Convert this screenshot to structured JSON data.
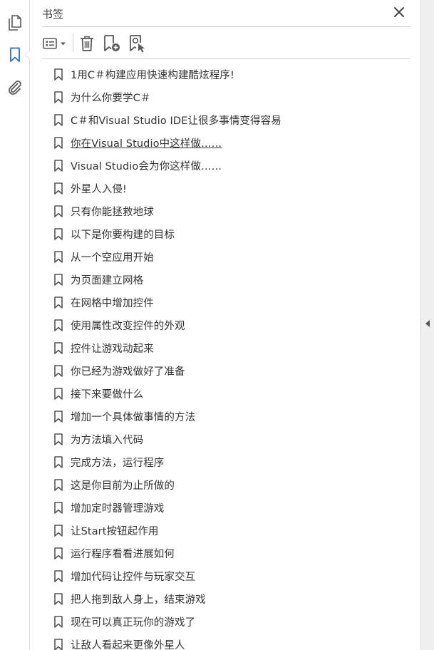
{
  "panel": {
    "title": "书签"
  },
  "icons": {
    "rail": [
      "pages-icon",
      "bookmark-icon",
      "attachment-icon"
    ],
    "toolbar": [
      "options-menu-icon",
      "delete-icon",
      "new-bookmark-icon",
      "bookmark-from-selection-icon"
    ],
    "close": "close-icon"
  },
  "colors": {
    "rail_active": "#2b6fc2",
    "icon_gray": "#5a5a5a",
    "text": "#333333"
  },
  "bookmarks": [
    {
      "label": "1用C＃构建应用快速构建酷炫程序!",
      "underlined": false
    },
    {
      "label": "为什么你要学C＃",
      "underlined": false
    },
    {
      "label": "C＃和Visual Studio IDE让很多事情变得容易",
      "underlined": false
    },
    {
      "label": "你在Visual Studio中这样做……",
      "underlined": true
    },
    {
      "label": "Visual Studio会为你这样做……",
      "underlined": false
    },
    {
      "label": "外星人入侵!",
      "underlined": false
    },
    {
      "label": "只有你能拯救地球",
      "underlined": false
    },
    {
      "label": "以下是你要构建的目标",
      "underlined": false
    },
    {
      "label": "从一个空应用开始",
      "underlined": false
    },
    {
      "label": "为页面建立网格",
      "underlined": false
    },
    {
      "label": "在网格中增加控件",
      "underlined": false
    },
    {
      "label": "使用属性改变控件的外观",
      "underlined": false
    },
    {
      "label": "控件让游戏动起来",
      "underlined": false
    },
    {
      "label": "你已经为游戏做好了准备",
      "underlined": false
    },
    {
      "label": "接下来要做什么",
      "underlined": false
    },
    {
      "label": "增加一个具体做事情的方法",
      "underlined": false
    },
    {
      "label": "为方法填入代码",
      "underlined": false
    },
    {
      "label": "完成方法，运行程序",
      "underlined": false
    },
    {
      "label": "这是你目前为止所做的",
      "underlined": false
    },
    {
      "label": "增加定时器管理游戏",
      "underlined": false
    },
    {
      "label": "让Start按钮起作用",
      "underlined": false
    },
    {
      "label": "运行程序看看进展如何",
      "underlined": false
    },
    {
      "label": "增加代码让控件与玩家交互",
      "underlined": false
    },
    {
      "label": "把人拖到敌人身上，结束游戏",
      "underlined": false
    },
    {
      "label": "现在可以真正玩你的游戏了",
      "underlined": false
    },
    {
      "label": "让敌人看起来更像外星人",
      "underlined": false
    }
  ]
}
